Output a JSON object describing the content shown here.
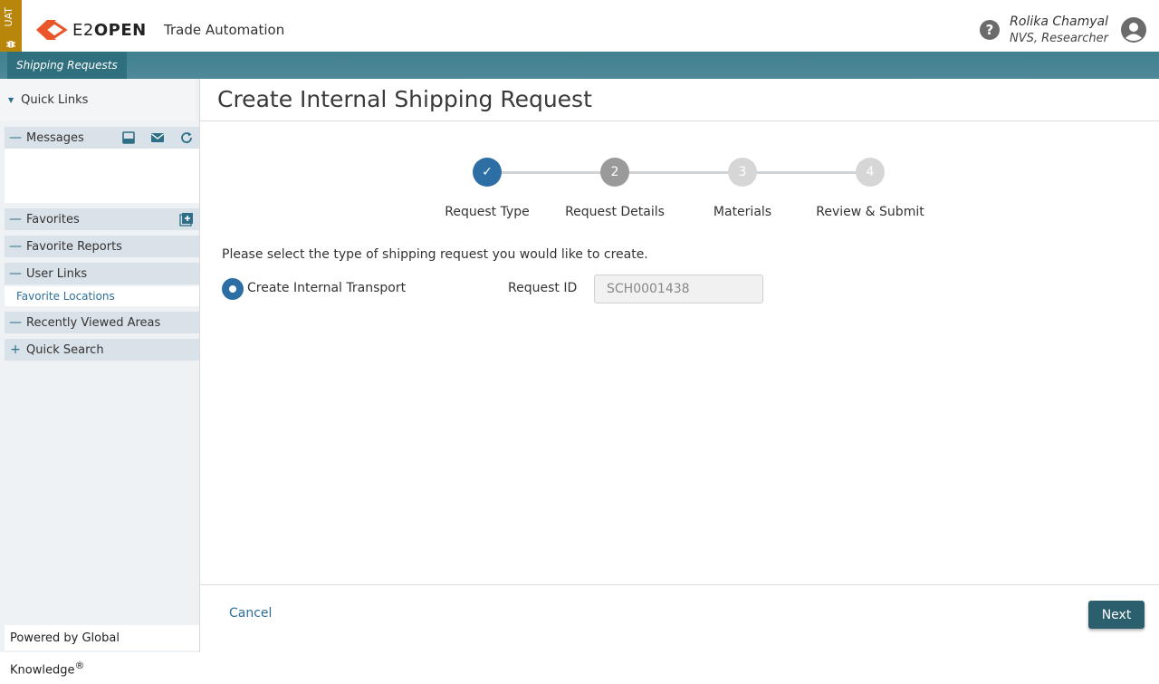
{
  "env": {
    "badge": "UAT"
  },
  "header": {
    "logo_prefix": "E2",
    "logo_bold": "OPEN",
    "app_title": "Trade Automation",
    "help": "?",
    "user_name": "Rolika Chamyal",
    "user_role": "NVS, Researcher"
  },
  "nav": {
    "tabs": [
      {
        "label": "Shipping Requests",
        "active": true
      }
    ]
  },
  "sidebar": {
    "quick_links": "Quick Links",
    "sections": [
      {
        "label": "Messages",
        "toggle": "—"
      },
      {
        "label": "Favorites",
        "toggle": "—"
      },
      {
        "label": "Favorite Reports",
        "toggle": "—"
      },
      {
        "label": "User Links",
        "toggle": "—"
      },
      {
        "label": "Recently Viewed Areas",
        "toggle": "—"
      },
      {
        "label": "Quick Search",
        "toggle": "+"
      }
    ],
    "user_links_items": [
      "Favorite Locations"
    ],
    "powered_by": "Powered by Global Knowledge",
    "powered_mark": "®"
  },
  "main": {
    "title": "Create Internal Shipping Request",
    "steps": [
      {
        "num": "✓",
        "label": "Request Type",
        "state": "done"
      },
      {
        "num": "2",
        "label": "Request Details",
        "state": "current"
      },
      {
        "num": "3",
        "label": "Materials",
        "state": "pending"
      },
      {
        "num": "4",
        "label": "Review & Submit",
        "state": "pending"
      }
    ],
    "prompt": "Please select the type of shipping request you would like to create.",
    "option_label": "Create Internal Transport",
    "request_id_label": "Request ID",
    "request_id_value": "SCH0001438"
  },
  "footer": {
    "cancel": "Cancel",
    "next": "Next"
  },
  "colors": {
    "accent": "#2c5f6d",
    "nav": "#4e8a99",
    "step_done": "#2d6fa5",
    "step_current": "#9a9a9a",
    "step_pending": "#d6d6d6",
    "link": "#2d6f9a"
  }
}
